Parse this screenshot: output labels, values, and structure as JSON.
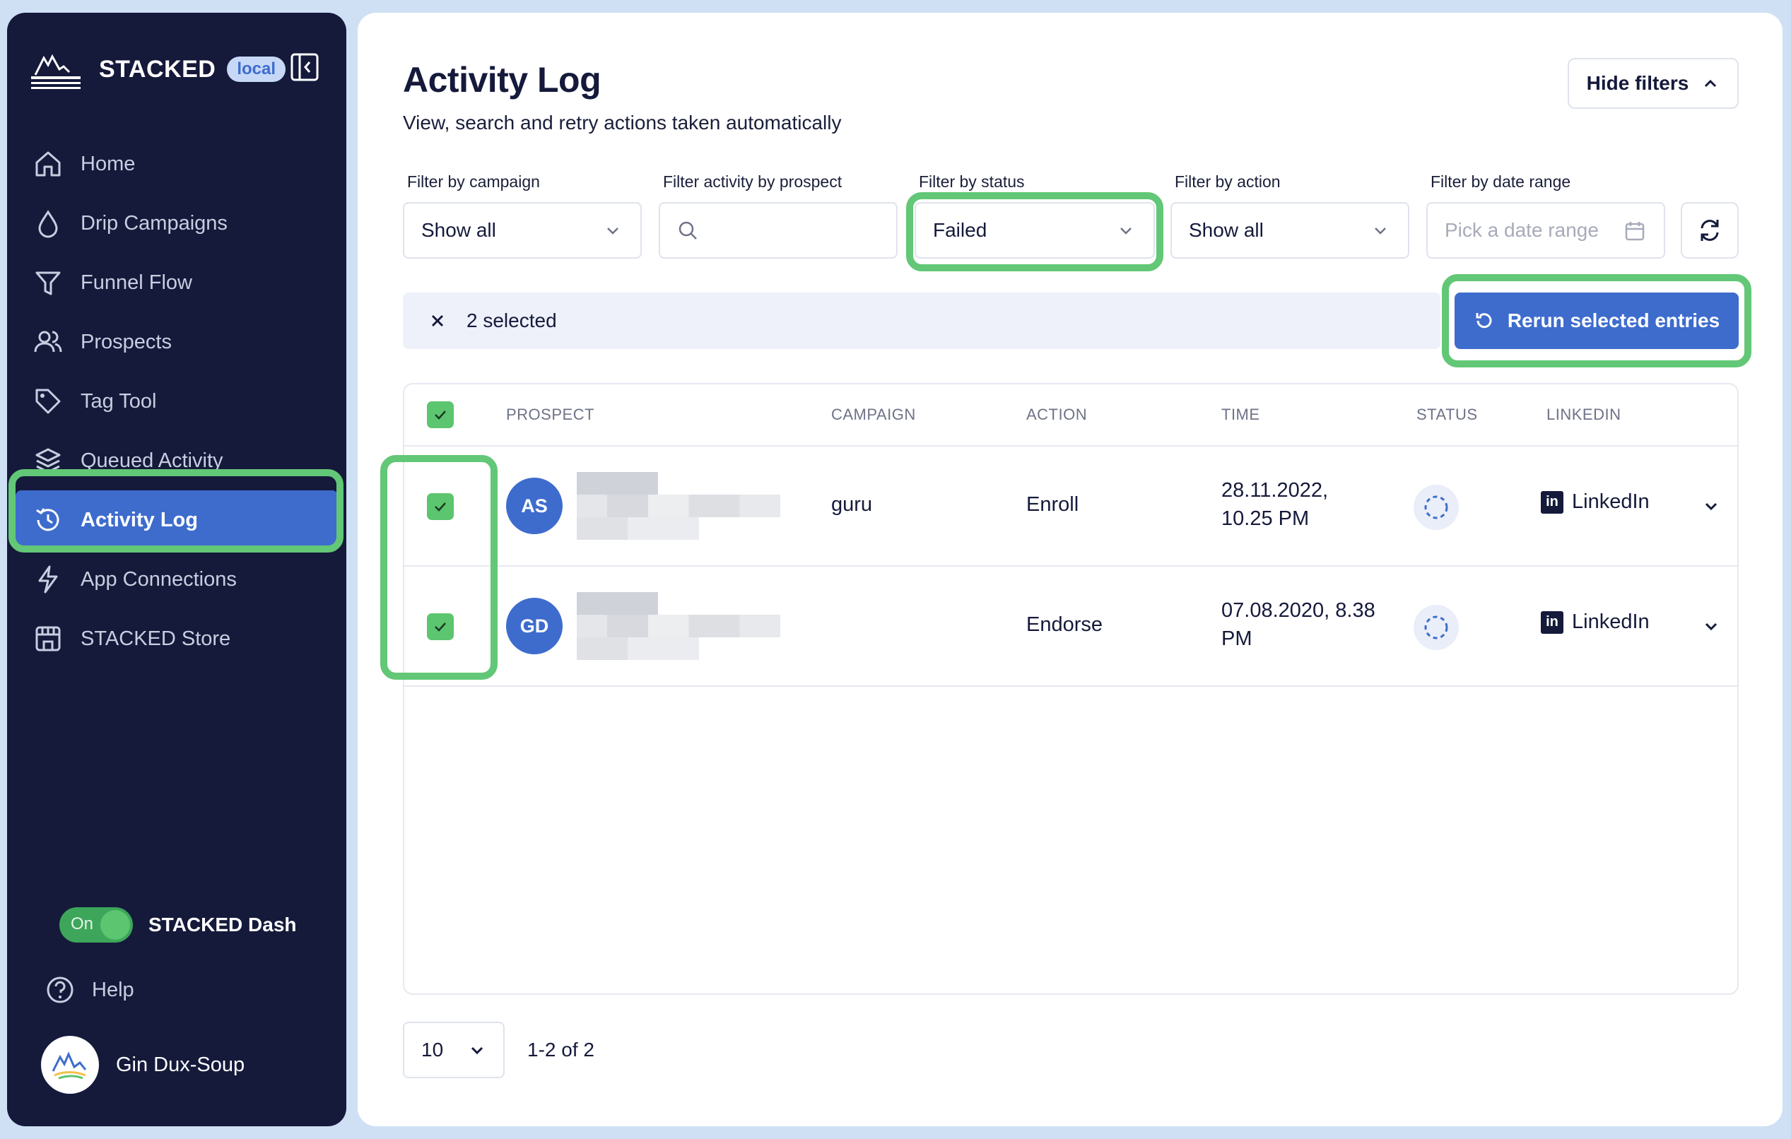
{
  "sidebar": {
    "brand": "STACKED",
    "env_badge": "local",
    "items": [
      {
        "label": "Home",
        "icon": "home-icon"
      },
      {
        "label": "Drip Campaigns",
        "icon": "drop-icon"
      },
      {
        "label": "Funnel Flow",
        "icon": "funnel-icon"
      },
      {
        "label": "Prospects",
        "icon": "users-icon"
      },
      {
        "label": "Tag Tool",
        "icon": "tag-icon"
      },
      {
        "label": "Queued Activity",
        "icon": "layers-icon"
      },
      {
        "label": "Activity Log",
        "icon": "history-icon",
        "active": true
      },
      {
        "label": "App Connections",
        "icon": "bolt-icon"
      },
      {
        "label": "STACKED Store",
        "icon": "store-icon"
      }
    ],
    "dash_toggle": {
      "state_label": "On",
      "label": "STACKED Dash"
    },
    "help": "Help",
    "user_name": "Gin Dux-Soup"
  },
  "header": {
    "title": "Activity Log",
    "subtitle": "View, search and retry actions taken automatically",
    "hide_filters": "Hide filters"
  },
  "filters": {
    "campaign": {
      "label": "Filter by campaign",
      "value": "Show all"
    },
    "prospect": {
      "label": "Filter activity by prospect",
      "value": ""
    },
    "status": {
      "label": "Filter by status",
      "value": "Failed"
    },
    "action": {
      "label": "Filter by action",
      "value": "Show all"
    },
    "date": {
      "label": "Filter by date range",
      "placeholder": "Pick a date range"
    }
  },
  "selection": {
    "count_text": "2 selected",
    "rerun_label": "Rerun selected entries"
  },
  "table": {
    "columns": [
      "PROSPECT",
      "CAMPAIGN",
      "ACTION",
      "TIME",
      "STATUS",
      "LINKEDIN"
    ],
    "rows": [
      {
        "initials": "AS",
        "campaign": "guru",
        "action": "Enroll",
        "time_line1": "28.11.2022,",
        "time_line2": "10.25 PM",
        "linkedin": "LinkedIn",
        "checked": true
      },
      {
        "initials": "GD",
        "campaign": "",
        "action": "Endorse",
        "time_line1": "07.08.2020, 8.38",
        "time_line2": "PM",
        "linkedin": "LinkedIn",
        "checked": true
      }
    ]
  },
  "pagination": {
    "page_size": "10",
    "range_text": "1-2 of 2"
  },
  "colors": {
    "accent": "#3e6ccd",
    "sidebar_bg": "#151a3b",
    "highlight": "#62c776",
    "checkbox": "#5bc56f"
  }
}
